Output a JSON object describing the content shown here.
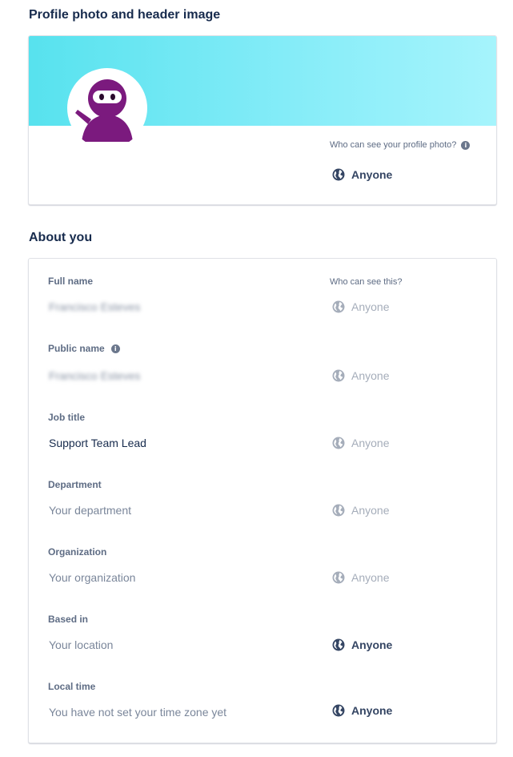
{
  "profile_section": {
    "title": "Profile photo and header image",
    "visibility_label": "Who can see your profile photo?",
    "visibility_value": "Anyone"
  },
  "about_section": {
    "title": "About you",
    "who_can_see_label": "Who can see this?",
    "fields": [
      {
        "label": "Full name",
        "value": "Francisco Esteves",
        "visibility": "Anyone"
      },
      {
        "label": "Public name",
        "value": "Francisco Esteves",
        "visibility": "Anyone"
      },
      {
        "label": "Job title",
        "value": "Support Team Lead",
        "visibility": "Anyone"
      },
      {
        "label": "Department",
        "placeholder": "Your department",
        "visibility": "Anyone"
      },
      {
        "label": "Organization",
        "placeholder": "Your organization",
        "visibility": "Anyone"
      },
      {
        "label": "Based in",
        "placeholder": "Your location",
        "visibility": "Anyone"
      },
      {
        "label": "Local time",
        "placeholder": "You have not set your time zone yet",
        "visibility": "Anyone"
      }
    ]
  },
  "icons": {
    "visibility": "globe-icon",
    "info": "info-icon"
  },
  "colors": {
    "header_gradient_start": "#57e2ee",
    "header_gradient_end": "#a6f4fc",
    "avatar_purple": "#7b1a7e",
    "text_primary": "#172b4d",
    "text_muted": "#5e6c84"
  }
}
